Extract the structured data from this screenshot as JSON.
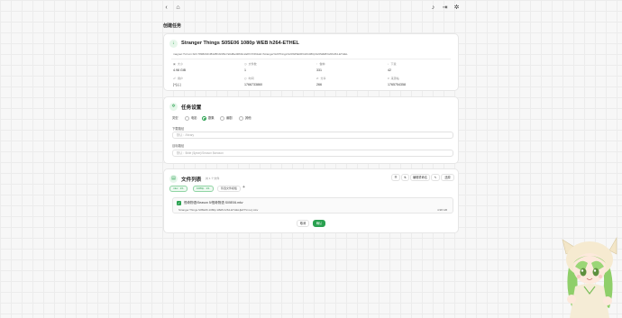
{
  "page": {
    "title": "创建任务"
  },
  "torrent": {
    "name": "Stranger Things S05E06 1080p WEB h264-ETHEL",
    "magnet": "magnet:?xt=urn:btih:78982021f8428f1bf4f6c7a6d8a43834c2a87cf7d6&dn=Stranger%20Things%20S05E06%201080p%20WEB%20h264-ETHEL",
    "stats": [
      {
        "icon": "size-icon",
        "label": "大小",
        "value": "4.98 GiB"
      },
      {
        "icon": "files-icon",
        "label": "文件数",
        "value": "1"
      },
      {
        "icon": "seeders-icon",
        "label": "做种",
        "value": "331"
      },
      {
        "icon": "download-icon",
        "label": "下载",
        "value": "42"
      },
      {
        "icon": "tracker-icon",
        "label": "用户",
        "value": "[+]-[-]"
      },
      {
        "icon": "date-icon",
        "label": "时间",
        "value": "1766733860"
      },
      {
        "icon": "peers-icon",
        "label": "分享",
        "value": "266"
      },
      {
        "icon": "hash-icon",
        "label": "来源站",
        "value": "1765754358"
      }
    ]
  },
  "settings": {
    "title": "任务设置",
    "type_label": "类型",
    "types": [
      {
        "label": "电影",
        "selected": false
      },
      {
        "label": "剧集",
        "selected": true
      },
      {
        "label": "番剧",
        "selected": false
      },
      {
        "label": "其他",
        "selected": false
      }
    ],
    "save_dir_label": "下载路径",
    "save_dir_placeholder": "默认：/library",
    "tag_label": "目标路径",
    "tag_placeholder": "默认：$title ($year)/Season $season",
    "colors": {
      "accent": "#2aa150"
    }
  },
  "files": {
    "title": "文件列表",
    "subtitle": "共 1 个文件",
    "toolbar": {
      "filter_btn": "☰",
      "sort_btn": "⇅",
      "rename_btn": "编辑重命名",
      "edit_btn": "✎",
      "reset_btn": "还原"
    },
    "tags": [
      {
        "label": "mkv",
        "count": "1/1"
      },
      {
        "label": "1080p",
        "count": "1/1"
      }
    ],
    "plain_tag": "筛选文件模板",
    "add_tag": "+",
    "list": [
      {
        "path": "怪奇物语/Season 5/怪奇物语 S05E06.mkv",
        "original": "Stranger.Things.S05E06.1080p.WEB.h264-ETHEL[EZTVx.to].mkv",
        "size": "4.98 GB"
      }
    ]
  },
  "actions": {
    "cancel": "取消",
    "confirm": "确认"
  }
}
